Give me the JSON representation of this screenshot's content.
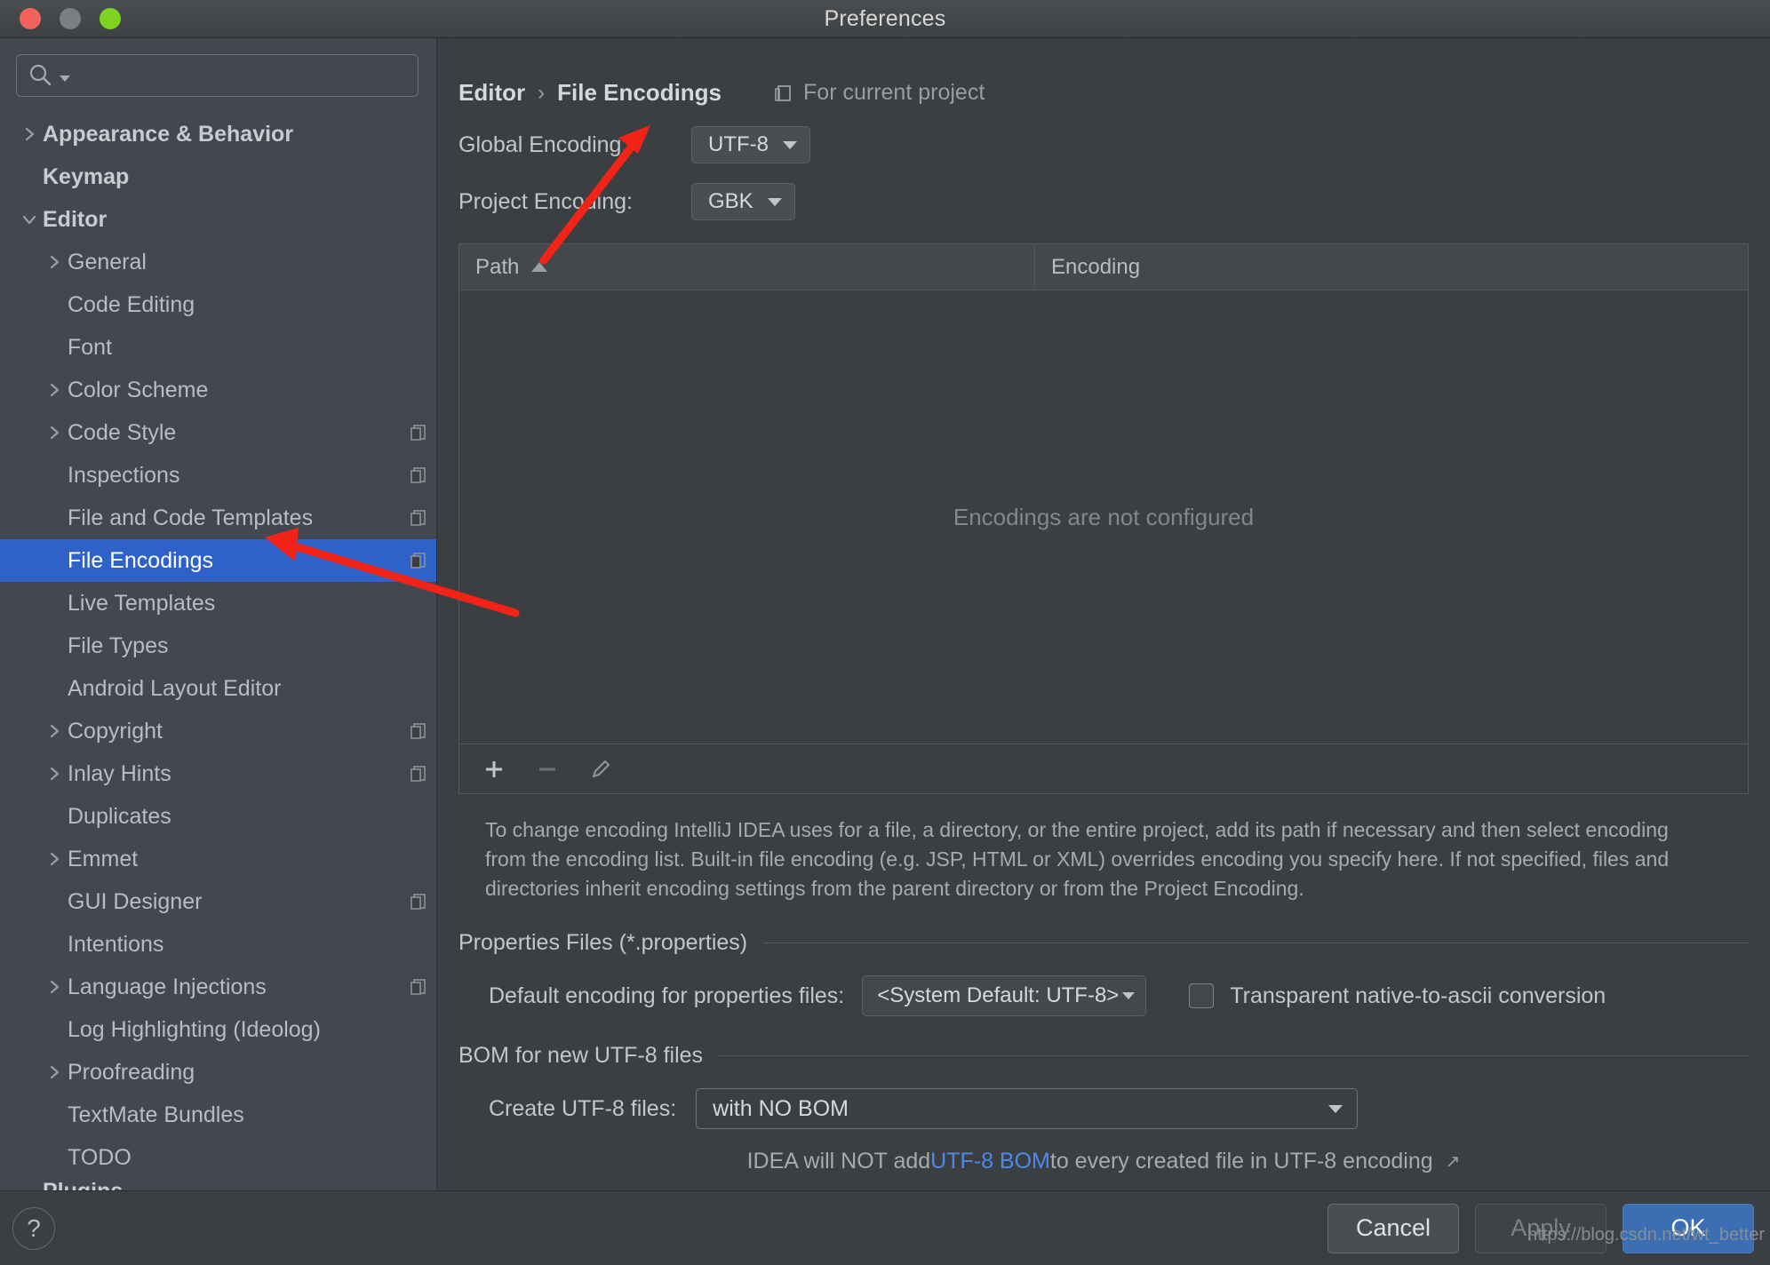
{
  "window": {
    "title": "Preferences",
    "traffic_lights": [
      "close",
      "minimize",
      "zoom"
    ]
  },
  "sidebar": {
    "search": {
      "placeholder": "",
      "value": ""
    },
    "items": [
      {
        "label": "Appearance & Behavior",
        "arrow": "right",
        "depth": 0,
        "bold": true,
        "badge": ""
      },
      {
        "label": "Keymap",
        "arrow": "none",
        "depth": 0,
        "bold": true,
        "badge": ""
      },
      {
        "label": "Editor",
        "arrow": "down",
        "depth": 0,
        "bold": true,
        "badge": ""
      },
      {
        "label": "General",
        "arrow": "right",
        "depth": 1,
        "bold": false,
        "badge": ""
      },
      {
        "label": "Code Editing",
        "arrow": "none",
        "depth": 1,
        "bold": false,
        "badge": ""
      },
      {
        "label": "Font",
        "arrow": "none",
        "depth": 1,
        "bold": false,
        "badge": ""
      },
      {
        "label": "Color Scheme",
        "arrow": "right",
        "depth": 1,
        "bold": false,
        "badge": ""
      },
      {
        "label": "Code Style",
        "arrow": "right",
        "depth": 1,
        "bold": false,
        "badge": "copy"
      },
      {
        "label": "Inspections",
        "arrow": "none",
        "depth": 1,
        "bold": false,
        "badge": "copy"
      },
      {
        "label": "File and Code Templates",
        "arrow": "none",
        "depth": 1,
        "bold": false,
        "badge": "copy"
      },
      {
        "label": "File Encodings",
        "arrow": "none",
        "depth": 1,
        "bold": false,
        "badge": "copy",
        "selected": true
      },
      {
        "label": "Live Templates",
        "arrow": "none",
        "depth": 1,
        "bold": false,
        "badge": ""
      },
      {
        "label": "File Types",
        "arrow": "none",
        "depth": 1,
        "bold": false,
        "badge": ""
      },
      {
        "label": "Android Layout Editor",
        "arrow": "none",
        "depth": 1,
        "bold": false,
        "badge": ""
      },
      {
        "label": "Copyright",
        "arrow": "right",
        "depth": 1,
        "bold": false,
        "badge": "copy"
      },
      {
        "label": "Inlay Hints",
        "arrow": "right",
        "depth": 1,
        "bold": false,
        "badge": "copy"
      },
      {
        "label": "Duplicates",
        "arrow": "none",
        "depth": 1,
        "bold": false,
        "badge": ""
      },
      {
        "label": "Emmet",
        "arrow": "right",
        "depth": 1,
        "bold": false,
        "badge": ""
      },
      {
        "label": "GUI Designer",
        "arrow": "none",
        "depth": 1,
        "bold": false,
        "badge": "copy"
      },
      {
        "label": "Intentions",
        "arrow": "none",
        "depth": 1,
        "bold": false,
        "badge": ""
      },
      {
        "label": "Language Injections",
        "arrow": "right",
        "depth": 1,
        "bold": false,
        "badge": "copy"
      },
      {
        "label": "Log Highlighting (Ideolog)",
        "arrow": "none",
        "depth": 1,
        "bold": false,
        "badge": ""
      },
      {
        "label": "Proofreading",
        "arrow": "right",
        "depth": 1,
        "bold": false,
        "badge": ""
      },
      {
        "label": "TextMate Bundles",
        "arrow": "none",
        "depth": 1,
        "bold": false,
        "badge": ""
      },
      {
        "label": "TODO",
        "arrow": "none",
        "depth": 1,
        "bold": false,
        "badge": ""
      },
      {
        "label": "Plugins",
        "arrow": "none",
        "depth": 0,
        "bold": true,
        "badge": "",
        "clipped": true
      }
    ]
  },
  "main": {
    "breadcrumb": {
      "parent": "Editor",
      "separator": "›",
      "current": "File Encodings",
      "scope_label": "For current project",
      "scope_icon": "project-scope-icon"
    },
    "global_encoding": {
      "label": "Global Encoding:",
      "value": "UTF-8"
    },
    "project_encoding": {
      "label": "Project Encoding:",
      "value": "GBK"
    },
    "table": {
      "columns": [
        "Path",
        "Encoding"
      ],
      "sort_column": "Path",
      "sort_direction": "asc",
      "rows": [],
      "empty_message": "Encodings are not configured",
      "toolbar": {
        "add": "+",
        "remove": "−",
        "edit": "pencil-icon"
      }
    },
    "hint": "To change encoding IntelliJ IDEA uses for a file, a directory, or the entire project, add its path if necessary and then select encoding from the encoding list. Built-in file encoding (e.g. JSP, HTML or XML) overrides encoding you specify here. If not specified, files and directories inherit encoding settings from the parent directory or from the Project Encoding.",
    "properties_section": {
      "title": "Properties Files (*.properties)",
      "default_encoding_label": "Default encoding for properties files:",
      "default_encoding_value": "<System Default: UTF-8>",
      "transparent_label": "Transparent native-to-ascii conversion",
      "transparent_checked": false
    },
    "bom_section": {
      "title": "BOM for new UTF-8 files",
      "create_label": "Create UTF-8 files:",
      "create_value": "with NO BOM",
      "note_prefix": "IDEA will NOT add ",
      "note_link": "UTF-8 BOM",
      "note_suffix": " to every created file in UTF-8 encoding"
    }
  },
  "footer": {
    "help": "?",
    "cancel": "Cancel",
    "apply": "Apply",
    "ok": "OK"
  },
  "watermark": "https://blog.csdn.net/wt_better",
  "colors": {
    "accent_selected": "#2f62c9",
    "primary_button": "#3c6eb4",
    "link": "#4c89e8",
    "annotation_arrow": "#f42318",
    "sidebar_bg": "#434750",
    "main_bg": "#3c3f41"
  }
}
